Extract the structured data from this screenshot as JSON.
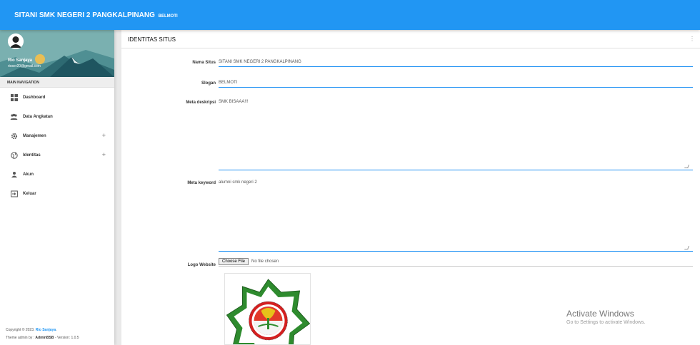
{
  "topbar": {
    "brand": "SITANI SMK NEGERI 2 PANGKALPINANG",
    "brand_small": "BELMOTI"
  },
  "user": {
    "name": "Rio Sanjaya",
    "email": "rioser20@gmail.com"
  },
  "sidebar": {
    "header": "MAIN NAVIGATION",
    "items": [
      {
        "label": "Dashboard",
        "icon": "dashboard-icon",
        "expand": ""
      },
      {
        "label": "Data Angkatan",
        "icon": "group-icon",
        "expand": ""
      },
      {
        "label": "Manajemen",
        "icon": "gear-icon",
        "expand": "+"
      },
      {
        "label": "Identitas",
        "icon": "globe-icon",
        "expand": "+"
      },
      {
        "label": "Akun",
        "icon": "person-icon",
        "expand": ""
      },
      {
        "label": "Keluar",
        "icon": "logout-icon",
        "expand": ""
      }
    ],
    "footer": {
      "copyright_prefix": "Copyright © 2023.",
      "copyright_name": "Rio Sanjaya",
      "copyright_suffix": ".",
      "theme_prefix": "Theme admin by :",
      "theme_name": "AdminBSB",
      "theme_suffix": "- Version: 1.0.5"
    }
  },
  "card": {
    "title": "IDENTITAS SITUS",
    "menu_glyph": "⋮",
    "fields": {
      "nama_situs": {
        "label": "Nama Situs",
        "value": "SITANI SMK NEGERI 2 PANGKALPINANG"
      },
      "slogan": {
        "label": "Slogan",
        "value": "BELMOTI"
      },
      "meta_deskripsi": {
        "label": "Meta deskripsi",
        "value": "SMK BISAAA!!!"
      },
      "meta_keyword": {
        "label": "Meta keyword",
        "value": "alumni smk negeri 2"
      },
      "logo": {
        "label": "Logo Website",
        "button": "Choose File",
        "status": "No file chosen"
      }
    }
  },
  "watermark": {
    "title": "Activate Windows",
    "subtitle": "Go to Settings to activate Windows."
  },
  "colors": {
    "primary": "#2196f3",
    "underline": "#1f91f3"
  }
}
